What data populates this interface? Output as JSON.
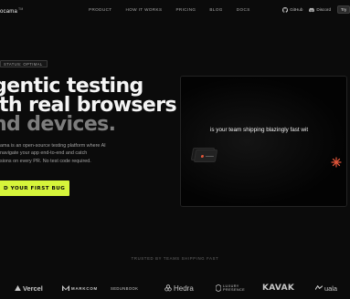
{
  "nav": {
    "brand": "ocama",
    "brand_badge": "TM",
    "links": [
      "PRODUCT",
      "HOW IT WORKS",
      "PRICING",
      "BLOG",
      "DOCS"
    ],
    "github_label": "GitHub",
    "discord_label": "Discord",
    "cta_label": "Try"
  },
  "hero": {
    "badge": "STATUS: OPTIMAL",
    "headline_1": "gentic testing",
    "headline_2": "ith real browsers",
    "headline_3": "nd devices.",
    "description_lines": [
      "ama is an open-source testing platform where AI",
      "navigate your app end-to-end and catch",
      "sions on every PR. No test code required."
    ],
    "cta_label": "D YOUR FIRST BUG"
  },
  "demo": {
    "typing_text": "is your team shipping blazingly fast wit"
  },
  "trusted": {
    "label": "TRUSTED BY TEAMS SHIPPING FAST",
    "logos": [
      "Vercel",
      "MARKCOM",
      "SEDUNBOOK",
      "Hedra",
      "LUXURY",
      "PRESENCE",
      "KAVAK",
      "uala"
    ]
  },
  "colors": {
    "accent": "#d6f53b",
    "background": "#0b0b0b",
    "star": "#e2563a"
  },
  "icons": [
    "github-icon",
    "discord-icon",
    "asterisk-star-icon",
    "vercel-triangle-icon",
    "markcom-m-icon",
    "hedra-icon",
    "uala-arrow-icon"
  ]
}
